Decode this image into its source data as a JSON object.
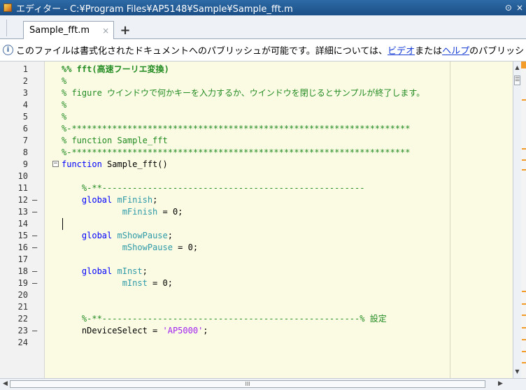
{
  "window": {
    "title": "エディター - C:¥Program Files¥AP5148¥Sample¥Sample_fft.m",
    "menu_glyph": "⊙",
    "close_glyph": "×"
  },
  "tabs": [
    {
      "label": "Sample_fft.m",
      "close_glyph": "×"
    }
  ],
  "tab_add_glyph": "+",
  "infobar": {
    "icon_glyph": "i",
    "text_before": "このファイルは書式化されたドキュメントへのパブリッシュが可能です。詳細については、",
    "link_video": "ビデオ",
    "text_middle": " または ",
    "link_help": "ヘルプ",
    "text_after": " のパブリッシ"
  },
  "editor": {
    "lines": [
      {
        "num": "1",
        "bp": "",
        "kind": "cell",
        "text": "%% fft(高速フーリエ変換)"
      },
      {
        "num": "2",
        "bp": "",
        "kind": "comment",
        "text": "%"
      },
      {
        "num": "3",
        "bp": "",
        "kind": "comment",
        "text": "% figure ウインドウで何かキーを入力するか、ウインドウを閉じるとサンプルが終了します。"
      },
      {
        "num": "4",
        "bp": "",
        "kind": "comment",
        "text": "%"
      },
      {
        "num": "5",
        "bp": "",
        "kind": "comment",
        "text": "%"
      },
      {
        "num": "6",
        "bp": "",
        "kind": "comment",
        "text": "%-*******************************************************************"
      },
      {
        "num": "7",
        "bp": "",
        "kind": "comment",
        "text": "% function Sample_fft"
      },
      {
        "num": "8",
        "bp": "",
        "kind": "comment",
        "text": "%-*******************************************************************"
      },
      {
        "num": "9",
        "bp": "",
        "kind": "func",
        "kw": "function",
        "rest": " Sample_fft()"
      },
      {
        "num": "10",
        "bp": "",
        "kind": "blank",
        "text": ""
      },
      {
        "num": "11",
        "bp": "",
        "kind": "comment",
        "indent": "    ",
        "text": "%-**----------------------------------------------------"
      },
      {
        "num": "12",
        "bp": "–",
        "kind": "global",
        "indent": "    ",
        "kw": "global",
        "var": "mFinish",
        "tail": ";"
      },
      {
        "num": "13",
        "bp": "–",
        "kind": "assign",
        "indent": "            ",
        "var": "mFinish",
        "tail": " = 0;"
      },
      {
        "num": "14",
        "bp": "",
        "kind": "caret",
        "text": ""
      },
      {
        "num": "15",
        "bp": "–",
        "kind": "global",
        "indent": "    ",
        "kw": "global",
        "var": "mShowPause",
        "tail": ";"
      },
      {
        "num": "16",
        "bp": "–",
        "kind": "assign",
        "indent": "            ",
        "var": "mShowPause",
        "tail": " = 0;"
      },
      {
        "num": "17",
        "bp": "",
        "kind": "blank",
        "text": ""
      },
      {
        "num": "18",
        "bp": "–",
        "kind": "global",
        "indent": "    ",
        "kw": "global",
        "var": "mInst",
        "tail": ";"
      },
      {
        "num": "19",
        "bp": "–",
        "kind": "assign",
        "indent": "            ",
        "var": "mInst",
        "tail": " = 0;"
      },
      {
        "num": "20",
        "bp": "",
        "kind": "blank",
        "text": ""
      },
      {
        "num": "21",
        "bp": "",
        "kind": "blank",
        "text": ""
      },
      {
        "num": "22",
        "bp": "",
        "kind": "comment",
        "indent": "    ",
        "text": "%-**---------------------------------------------------% 設定"
      },
      {
        "num": "23",
        "bp": "–",
        "kind": "string",
        "indent": "    ",
        "pre": "nDeviceSelect = ",
        "str": "'AP5000'",
        "tail": ";"
      },
      {
        "num": "24",
        "bp": "",
        "kind": "blank",
        "text": ""
      }
    ]
  },
  "scrollbars": {
    "v_thumb_glyph": "☰",
    "h_thumb_glyph": "III",
    "up_glyph": "▲",
    "down_glyph": "▼",
    "left_glyph": "◀",
    "right_glyph": "▶"
  },
  "colors": {
    "editor_bg": "#fbfbe3",
    "comment": "#228b22",
    "keyword": "#0000ff",
    "variable": "#2e9aa8",
    "string": "#a020f0",
    "marker": "#f39c2a"
  }
}
